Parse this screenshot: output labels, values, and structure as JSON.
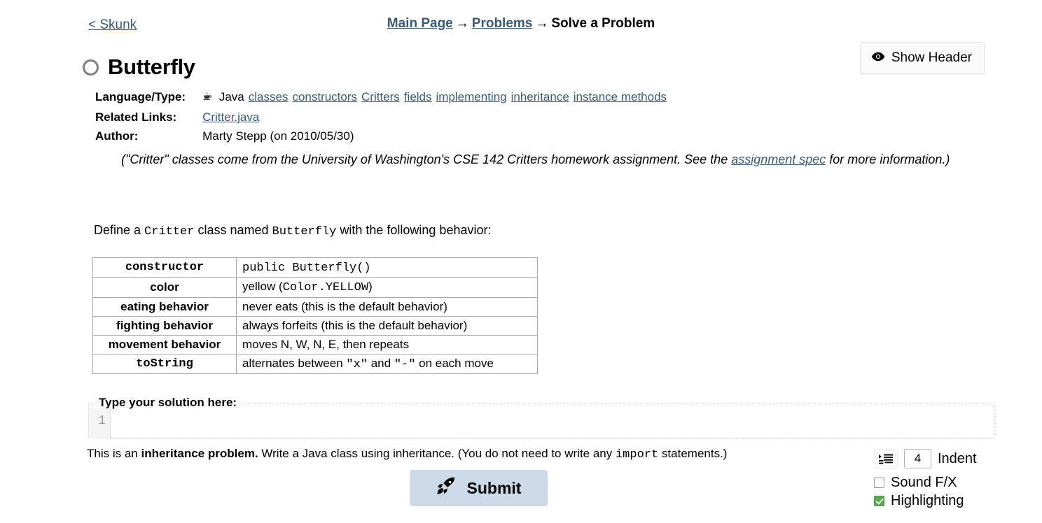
{
  "nav": {
    "back_label": "< Skunk",
    "breadcrumb": {
      "item1": "Main Page",
      "sep1": "→",
      "item2": "Problems",
      "sep2": "→",
      "current": "Solve a Problem"
    },
    "show_header_label": "Show Header",
    "show_header_icon": "eye-icon"
  },
  "problem": {
    "title": "Butterfly",
    "status_icon": "empty-circle-icon",
    "meta": {
      "language_label": "Language/Type:",
      "language_icon": "java-coffee-cup-icon",
      "language_value": "Java",
      "tags": [
        "classes",
        "constructors",
        "Critters",
        "fields",
        "implementing",
        "inheritance",
        "instance methods"
      ],
      "related_links_label": "Related Links:",
      "related_links": [
        "Critter.java"
      ],
      "author_label": "Author:",
      "author_value": "Marty Stepp (on 2010/05/30)"
    },
    "note": {
      "part1": "(\"Critter\" classes come from the University of Washington's CSE 142 Critters homework assignment. See the ",
      "link": "assignment spec",
      "part2": " for more information.)"
    },
    "define": {
      "prefix": "Define a ",
      "base_class": "Critter",
      "middle": " class named ",
      "class_name": "Butterfly",
      "suffix": " with the following behavior:"
    },
    "behavior_table": {
      "rows": [
        {
          "name": "constructor",
          "name_mono": true,
          "value": "public Butterfly()",
          "value_mono": true
        },
        {
          "name": "color",
          "name_mono": false,
          "value": "yellow (Color.YELLOW)",
          "value_mono": false
        },
        {
          "name": "eating behavior",
          "name_mono": false,
          "value": "never eats (this is the default behavior)",
          "value_mono": false
        },
        {
          "name": "fighting behavior",
          "name_mono": false,
          "value": "always forfeits (this is the default behavior)",
          "value_mono": false
        },
        {
          "name": "movement behavior",
          "name_mono": false,
          "value": "moves N, W, N, E, then repeats",
          "value_mono": false
        },
        {
          "name": "toString",
          "name_mono": true,
          "value": "alternates between \"x\" and \"-\" on each move",
          "value_mono": false
        }
      ]
    }
  },
  "editor": {
    "legend": "Type your solution here:",
    "line_number": "1",
    "code_value": "",
    "placeholder": ""
  },
  "hint": {
    "prefix": "This is an ",
    "bold": "inheritance problem.",
    "middle": " Write a Java class using inheritance. (You do not need to write any ",
    "code": "import",
    "suffix": " statements.)"
  },
  "actions": {
    "submit_label": "Submit",
    "submit_icon": "rocket-icon",
    "submit_bg": "#ccd9e6"
  },
  "options": {
    "indent_icon": "indent-lines-icon",
    "indent_value": "4",
    "indent_label": "Indent",
    "sound_fx_label": "Sound F/X",
    "sound_fx_checked": false,
    "highlighting_label": "Highlighting",
    "highlighting_checked": true,
    "check_color": "#5aa84f"
  }
}
